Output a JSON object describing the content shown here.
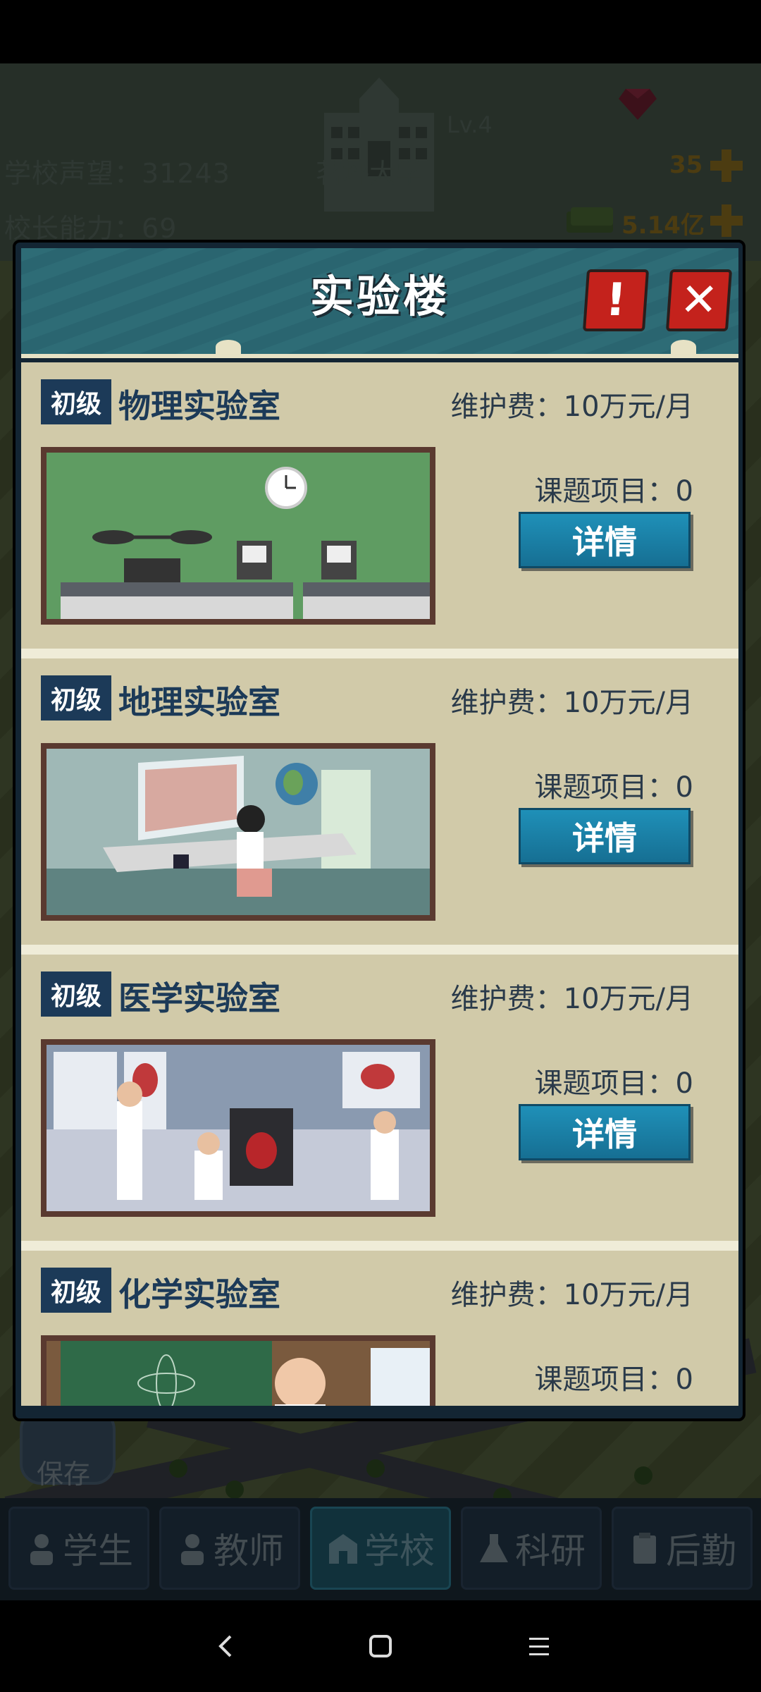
{
  "hud": {
    "reputation_label": "学校声望：",
    "reputation_value": "31243",
    "principal_label": "校长能力：",
    "principal_value": "69",
    "school_level": "Lv.4",
    "school_name": "茗坪大学",
    "gems": "35",
    "money": "5.14亿"
  },
  "save_label": "保存",
  "modal": {
    "title": "实验楼",
    "labs": [
      {
        "level": "初级",
        "name": "物理实验室",
        "fee_label": "维护费：",
        "fee": "10万元/月",
        "projects_label": "课题项目：",
        "projects": "0",
        "detail_label": "详情"
      },
      {
        "level": "初级",
        "name": "地理实验室",
        "fee_label": "维护费：",
        "fee": "10万元/月",
        "projects_label": "课题项目：",
        "projects": "0",
        "detail_label": "详情"
      },
      {
        "level": "初级",
        "name": "医学实验室",
        "fee_label": "维护费：",
        "fee": "10万元/月",
        "projects_label": "课题项目：",
        "projects": "0",
        "detail_label": "详情"
      },
      {
        "level": "初级",
        "name": "化学实验室",
        "fee_label": "维护费：",
        "fee": "10万元/月",
        "projects_label": "课题项目：",
        "projects": "0"
      }
    ]
  },
  "tabs": [
    {
      "label": "学生",
      "icon": "student-icon"
    },
    {
      "label": "教师",
      "icon": "teacher-icon"
    },
    {
      "label": "学校",
      "icon": "school-icon"
    },
    {
      "label": "科研",
      "icon": "research-icon"
    },
    {
      "label": "后勤",
      "icon": "logistics-icon"
    }
  ],
  "active_tab": "学校",
  "colors": {
    "accent": "#1f90b8",
    "badge": "#1c3a58",
    "close_button": "#c4221c"
  }
}
